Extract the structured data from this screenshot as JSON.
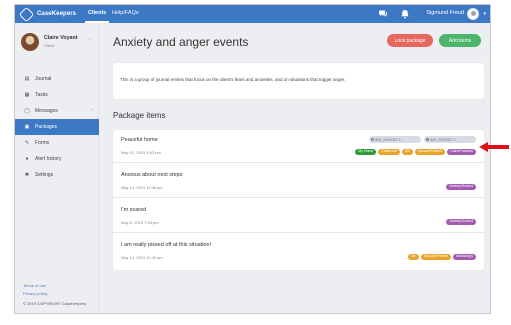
{
  "app": {
    "name": "CaseKeepers",
    "nav": {
      "clients": "Clients",
      "help": "Help/FAQs"
    },
    "user": {
      "name": "Sigmund Freud"
    }
  },
  "sidebar": {
    "client": {
      "name": "Claire Voyant",
      "subtitle": "Client"
    },
    "items": [
      {
        "label": "Journal",
        "icon": "journal-icon"
      },
      {
        "label": "Tasks",
        "icon": "tasks-icon"
      },
      {
        "label": "Messages",
        "icon": "messages-icon"
      },
      {
        "label": "Packages",
        "icon": "packages-icon"
      },
      {
        "label": "Forms",
        "icon": "forms-icon"
      },
      {
        "label": "Alert history",
        "icon": "alert-icon"
      },
      {
        "label": "Settings",
        "icon": "gear-icon"
      }
    ],
    "footer": {
      "terms": "Terms of use",
      "privacy": "Privacy policy",
      "copyright": "© 2019 COPYRIGHT CaseKeepers"
    }
  },
  "page": {
    "title": "Anxiety and anger events",
    "buttons": {
      "lock": "Lock package",
      "add": "Add items"
    },
    "description": "This is a group of journal entries that focus on the client's fears and anxieties, and on situations that trigger anger.",
    "section_title": "Package items"
  },
  "items": [
    {
      "title": "Peaceful home",
      "date": "May 12, 2019 4:53 pm",
      "files": [
        "IMG_20190327 1...",
        "IMG_20190327 1..."
      ],
      "tags": [
        "My Home",
        "Childhood",
        "Me",
        "Spouse/Partner",
        "Calm/Peaceful"
      ]
    },
    {
      "title": "Anxious about next steps",
      "date": "May 14, 2019 11:46 am",
      "files": [],
      "tags": [
        "Anxiety/Scared"
      ]
    },
    {
      "title": "I'm scared",
      "date": "May 6, 2019 7:43 pm",
      "files": [],
      "tags": [
        "Anxiety/Scared"
      ]
    },
    {
      "title": "I am really pissed off at this situation!",
      "date": "May 14, 2019 11:49 am",
      "files": [],
      "tags": [
        "Me",
        "Spouse/Partner",
        "Mad/Angry"
      ]
    }
  ],
  "colors": {
    "primary": "#3d78c4",
    "lock": "#e5675f",
    "add": "#4cb56a",
    "arrow": "#e0101a",
    "tag_colors": {
      "My Home": "#2b9b3a",
      "Childhood": "#e8a42a",
      "Me": "#e8a42a",
      "Spouse/Partner": "#e8a42a",
      "Calm/Peaceful": "#a35bb0",
      "Anxiety/Scared": "#a35bb0",
      "Mad/Angry": "#a35bb0"
    }
  }
}
